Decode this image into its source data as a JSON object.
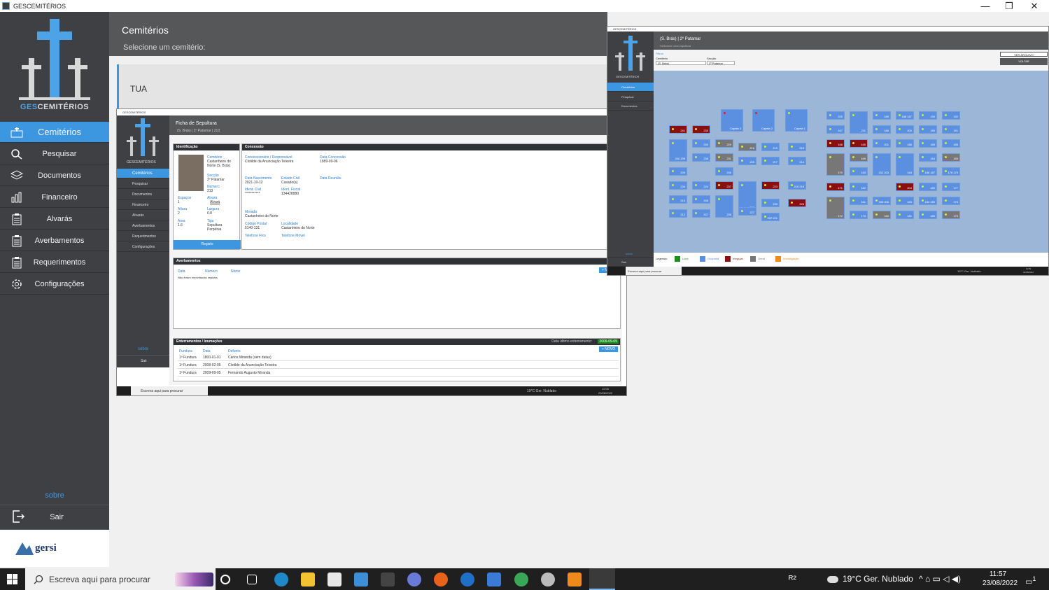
{
  "window": {
    "title": "GESCEMITÉRIOS",
    "controls": [
      "—",
      "❐",
      "✕"
    ]
  },
  "logo": {
    "text_a": "GES",
    "text_b": "CEMITÉRIOS"
  },
  "sidebar": {
    "items": [
      {
        "label": "Cemitérios",
        "icon": "cemetery-icon"
      },
      {
        "label": "Pesquisar",
        "icon": "search-icon"
      },
      {
        "label": "Documentos",
        "icon": "documents-icon"
      },
      {
        "label": "Financeiro",
        "icon": "finance-icon"
      },
      {
        "label": "Alvarás",
        "icon": "clipboard-icon"
      },
      {
        "label": "Averbamentos",
        "icon": "clipboard-icon"
      },
      {
        "label": "Requerimentos",
        "icon": "clipboard-icon"
      },
      {
        "label": "Configurações",
        "icon": "settings-icon"
      }
    ],
    "sobre": "sobre",
    "sair": "Sair",
    "partner": "gersi"
  },
  "main": {
    "title": "Cemitérios",
    "subtitle": "Selecione um cemitério:",
    "cemetery_card": "TUA"
  },
  "ficha": {
    "window_title": "GESCEMITÉRIOS",
    "title": "Ficha de Sepultura",
    "subtitle": "(S. Brás) | 2º Patamar | 213",
    "nav": [
      "Cemitérios",
      "Pesquisar",
      "Documentos",
      "Financeiro",
      "Alvarás",
      "Averbamentos",
      "Requerimentos",
      "Configurações"
    ],
    "sobre": "sobre",
    "sair": "Sair",
    "identificacao": {
      "header": "Identificação",
      "cemiterio_label": "Cemitério",
      "cemiterio": "Castanheiro do Norte (S. Brás)",
      "seccao_label": "Secção",
      "seccao": "2º Patamar",
      "numero_label": "Número",
      "numero": "213",
      "espacos_label": "Espaços",
      "espacos": "1",
      "alvara_label": "Alvará",
      "alvara": "Alvará",
      "altura_label": "Altura",
      "altura": "2",
      "largura_label": "Largura",
      "largura": "0.8",
      "area_label": "Área",
      "area": "1.6",
      "tipo_label": "Tipo",
      "tipo": "Sepultura Perpétua",
      "registo": "Registo"
    },
    "concessao": {
      "header": "Concessão",
      "concessionario_label": "Concessionário / Responsável",
      "concessionario": "Clotilde da Anunciação Teixeira",
      "data_concessao_label": "Data Concessão",
      "data_concessao": "1989-09-06",
      "data_nascimento_label": "Data Nascimento",
      "data_nascimento": "2021-10-12",
      "estado_civil_label": "Estado Civil",
      "estado_civil": "Casado(a)",
      "data_reunião_label": "Data Reunião",
      "ident_civil_label": "Ident. Civil",
      "ident_civil": "***********",
      "ident_fiscal_label": "Ident. Fiscal",
      "ident_fiscal": "134428880",
      "morada_label": "Morada",
      "morada": "Castanheiro do Norte",
      "codigo_postal_label": "Código Postal",
      "codigo_postal": "5140-131",
      "localidade_label": "Localidade",
      "localidade": "Castanheiro do Norte",
      "tel_fixo_label": "Telefone Fixo",
      "tel_movel_label": "Telefone Móvel"
    },
    "averbamentos": {
      "header": "Averbamentos",
      "novo": "+ NOVO",
      "columns": [
        "Data",
        "Número",
        "Nome"
      ],
      "empty": "Não foram encontrados registos"
    },
    "enterramentos": {
      "header": "Enterramentos / Inumações",
      "last_label": "Data último enterramento:",
      "last_value": "2009-09-05",
      "novo": "+ NOVO",
      "columns": [
        "Fundura",
        "Data",
        "Defunto"
      ],
      "rows": [
        [
          "1ª Fundura",
          "1800-01-01",
          "Carlos Miranda (sem datas)"
        ],
        [
          "1ª Fundura",
          "2008-02-05",
          "Clotilde da Anunciação Teixeira"
        ],
        [
          "1ª Fundura",
          "2009-09-05",
          "Fernando Augusto Miranda"
        ]
      ]
    },
    "taskbar": {
      "search": "Escreva aqui para procurar",
      "weather": "19°C Ger. Nublado",
      "time": "12:00",
      "date": "23/08/2022"
    }
  },
  "plan": {
    "window_title": "GESCEMITÉRIOS",
    "title": "(S. Brás) | 2º Patamar",
    "subtitle": "Selecione uma sepultura",
    "filter_label": "Filtros",
    "cemiterio_label": "Cemitério",
    "cemiterio": "(S. Brás)",
    "seccao_label": "Secção",
    "seccao": "2º Patamar",
    "ver_arquivo": "VER ARQUIVO",
    "voltar": "VOLTAR",
    "nav": [
      "Cemitérios",
      "Pesquisar",
      "Documentos",
      "Financeiro",
      "Alvarás",
      "Averbamentos",
      "Requerimentos",
      "Configurações"
    ],
    "sobre": "sobre",
    "sair": "Sair",
    "legend_title": "Legenda:",
    "legend": [
      {
        "label": "Livre",
        "color": "#1a8f1a"
      },
      {
        "label": "Ocupada",
        "color": "#5b8fe0"
      },
      {
        "label": "Irregular",
        "color": "#8b0f0f"
      },
      {
        "label": "Geral",
        "color": "#777777"
      },
      {
        "label": "Investigação",
        "color": "#f08a1a"
      }
    ],
    "chapels": [
      "Capela 3",
      "Capela 2",
      "Capela 1"
    ],
    "graves": [
      {
        "n": "241",
        "s": "irregular"
      },
      {
        "n": "233",
        "s": "irregular"
      },
      {
        "n": "240 239",
        "s": "ocupada"
      },
      {
        "n": "230",
        "s": "ocupada"
      },
      {
        "n": "229",
        "s": "geral"
      },
      {
        "n": "216",
        "s": "geral"
      },
      {
        "n": "215",
        "s": "ocupada"
      },
      {
        "n": "210",
        "s": "ocupada"
      },
      {
        "n": "238",
        "s": "ocupada"
      },
      {
        "n": "231",
        "s": "geral"
      },
      {
        "n": "225",
        "s": "ocupada"
      },
      {
        "n": "217",
        "s": "ocupada"
      },
      {
        "n": "214",
        "s": "ocupada"
      },
      {
        "n": "209",
        "s": "ocupada"
      },
      {
        "n": "236",
        "s": "ocupada"
      },
      {
        "n": "234",
        "s": "ocupada"
      },
      {
        "n": "224",
        "s": "ocupada"
      },
      {
        "n": "237",
        "s": "irregular"
      },
      {
        "n": "228",
        "s": "ocupada"
      },
      {
        "n": "223",
        "s": "irregular"
      },
      {
        "n": "219 218",
        "s": "ocupada"
      },
      {
        "n": "213",
        "s": "ocupada"
      },
      {
        "n": "208",
        "s": "ocupada"
      },
      {
        "n": "235",
        "s": "ocupada"
      },
      {
        "n": "226",
        "s": "irregular"
      },
      {
        "n": "212",
        "s": "ocupada"
      },
      {
        "n": "207",
        "s": "ocupada"
      },
      {
        "n": "235",
        "s": "ocupada"
      },
      {
        "n": "227",
        "s": "ocupada"
      },
      {
        "n": "222 221",
        "s": "ocupada"
      },
      {
        "n": "220",
        "s": "ocupada"
      },
      {
        "n": "211",
        "s": "ocupada"
      },
      {
        "n": "189",
        "s": "ocupada"
      },
      {
        "n": "188 187",
        "s": "ocupada"
      },
      {
        "n": "190",
        "s": "ocupada"
      },
      {
        "n": "192",
        "s": "ocupada"
      },
      {
        "n": "167",
        "s": "ocupada"
      },
      {
        "n": "166",
        "s": "ocupada"
      },
      {
        "n": "200",
        "s": "ocupada"
      },
      {
        "n": "189",
        "s": "ocupada"
      },
      {
        "n": "191",
        "s": "ocupada"
      },
      {
        "n": "168",
        "s": "irregular"
      },
      {
        "n": "165",
        "s": "irregular"
      },
      {
        "n": "201",
        "s": "ocupada"
      },
      {
        "n": "186",
        "s": "ocupada"
      },
      {
        "n": "189",
        "s": "ocupada"
      },
      {
        "n": "185",
        "s": "ocupada"
      },
      {
        "n": "169",
        "s": "geral"
      },
      {
        "n": "164",
        "s": "ocupada"
      },
      {
        "n": "185",
        "s": "geral"
      },
      {
        "n": "170",
        "s": "geral"
      },
      {
        "n": "163",
        "s": "ocupada"
      },
      {
        "n": "202 203",
        "s": "ocupada"
      },
      {
        "n": "184",
        "s": "ocupada"
      },
      {
        "n": "186 187",
        "s": "ocupada"
      },
      {
        "n": "178 179",
        "s": "ocupada"
      },
      {
        "n": "171",
        "s": "irregular"
      },
      {
        "n": "162",
        "s": "ocupada"
      },
      {
        "n": "204",
        "s": "irregular"
      },
      {
        "n": "182",
        "s": "ocupada"
      },
      {
        "n": "177",
        "s": "ocupada"
      },
      {
        "n": "172",
        "s": "geral"
      },
      {
        "n": "161",
        "s": "ocupada"
      },
      {
        "n": "205 206",
        "s": "ocupada"
      },
      {
        "n": "183",
        "s": "ocupada"
      },
      {
        "n": "184 185",
        "s": "ocupada"
      },
      {
        "n": "176",
        "s": "ocupada"
      },
      {
        "n": "173",
        "s": "ocupada"
      },
      {
        "n": "160",
        "s": "geral"
      },
      {
        "n": "181",
        "s": "ocupada"
      },
      {
        "n": "180",
        "s": "ocupada"
      },
      {
        "n": "175",
        "s": "geral"
      },
      {
        "n": "174",
        "s": "ocupada"
      },
      {
        "n": "159",
        "s": "irregular"
      }
    ],
    "taskbar": {
      "search": "Escreva aqui para procurar",
      "weather": "19°C Ger. Nublado",
      "time": "11:59",
      "date": "23/08/2022"
    }
  },
  "taskbar": {
    "search_placeholder": "Escreva aqui para procurar",
    "weather": "19°C  Ger. Nublado",
    "time": "11:57",
    "date": "23/08/2022",
    "notifications": "1"
  },
  "colors": {
    "accent": "#3d96e0",
    "sidebar": "#3e4044",
    "header": "#555759",
    "irregular": "#8b0f0f",
    "geral": "#777777",
    "ocupada": "#5b8fe0"
  }
}
